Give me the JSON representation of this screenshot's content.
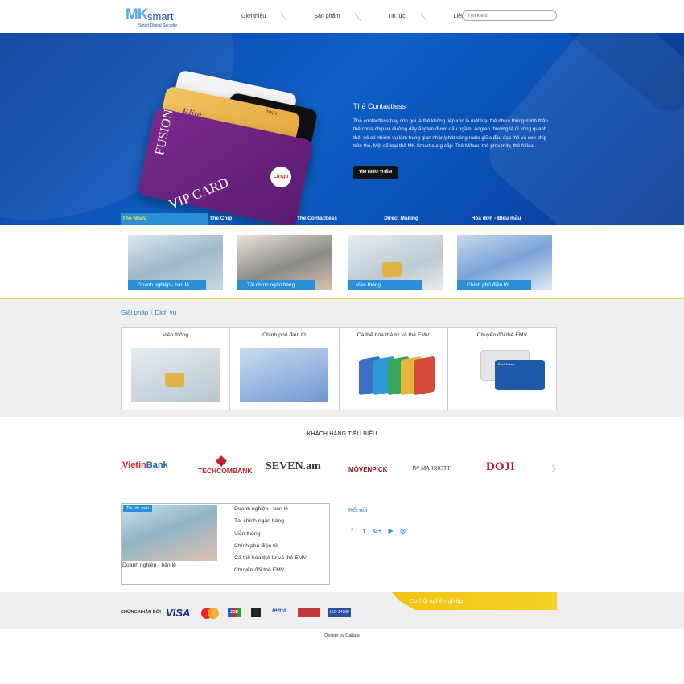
{
  "header": {
    "logo": {
      "mk": "MK",
      "smart": "smart",
      "tagline": "Smart Digital Security"
    },
    "nav": [
      {
        "label": "Giới thiệu"
      },
      {
        "label": "Sản phẩm"
      },
      {
        "label": "Tin tức"
      },
      {
        "label": "Liên hệ"
      }
    ],
    "search_placeholder": "Tìm kiếm"
  },
  "hero": {
    "title": "Thẻ Contactless",
    "description": "Thẻ contactless hay còn gọi là thẻ không tiếp xúc là một loại thẻ nhựa thông minh thân thẻ chứa chip và đường dây ăngten được dấu ngầm. Ăngten thường là đi vòng quanh thẻ, nó có nhiệm vụ làm trung gian nhận/phát sóng radio giữa đầu đọc thẻ và con chip trên thẻ.  Một số loại thẻ MK Smart cung cấp: Thẻ Mifare, thẻ proximity, thẻ felica.",
    "button": "TÌM HIỂU THÊM",
    "card_texts": {
      "fusion": "FUSION",
      "vip": "VIP CARD",
      "elite": "Elite",
      "tinh": "TINH",
      "badge": "Lingo"
    },
    "tabs": [
      {
        "label": "Thẻ Nhựa",
        "active": true
      },
      {
        "label": "Thẻ Chip",
        "active": false
      },
      {
        "label": "Thẻ Contactless",
        "active": false
      },
      {
        "label": "Direct Mailing",
        "active": false
      },
      {
        "label": "Hóa đơn - Biểu mẫu",
        "active": false
      }
    ]
  },
  "categories": [
    {
      "label": "Doanh nghiệp - bán lẻ"
    },
    {
      "label": "Tài chính ngân hàng"
    },
    {
      "label": "Viễn thông"
    },
    {
      "label": "Chính phủ điện tử"
    }
  ],
  "solutions": {
    "crumb": [
      "Giải pháp",
      "Dịch vụ"
    ],
    "crumb_sep": "\\",
    "items": [
      {
        "title": "Viễn thông"
      },
      {
        "title": "Chính phủ điện tử"
      },
      {
        "title": "Cá thể hóa thẻ từ và thẻ EMV"
      },
      {
        "title": "Chuyển đổi thẻ EMV"
      }
    ],
    "bank_card_text": "Bank Name"
  },
  "clients": {
    "title": "KHÁCH HÀNG TIÊU BIỂU",
    "logos": [
      {
        "name": "VietinBank",
        "prefix": "Vietin",
        "suffix": "Bank"
      },
      {
        "name": "TECHCOMBANK"
      },
      {
        "name": "SEVEN.am"
      },
      {
        "name": "MÖVENPICK"
      },
      {
        "name": "JW MARRIOTT"
      },
      {
        "name": "DOJI"
      }
    ]
  },
  "news": {
    "tag": "Tin tức mới",
    "caption": "Doanh nghiệp - bán lẻ",
    "items": [
      "Doanh nghiệp - bán lẻ",
      "Tài chính ngân hàng",
      "Viễn thông",
      "Chính phủ điện tử",
      "Cá thể hóa thẻ từ và thẻ EMV",
      "Chuyển đổi thẻ EMV"
    ]
  },
  "connect": {
    "title": "Kết nối",
    "socials": [
      {
        "icon": "facebook-icon",
        "glyph": "f"
      },
      {
        "icon": "twitter-icon",
        "glyph": "t"
      },
      {
        "icon": "google-plus-icon",
        "glyph": "G+"
      },
      {
        "icon": "youtube-icon",
        "glyph": "▶"
      },
      {
        "icon": "instagram-icon",
        "glyph": "◎"
      }
    ]
  },
  "certifications": {
    "label": "CHỨNG NHẬN BỞI",
    "visa": "VISA",
    "jcb": "JCB",
    "iema": "iema",
    "iso": "ISO 14000"
  },
  "career": {
    "label": "Cơ hội nghề nghiệp",
    "arrow": "→"
  },
  "footer": {
    "credit": "Design by Caitato"
  },
  "colors": {
    "brand_blue": "#1a4fa3",
    "accent_blue": "#2a8fd6",
    "yellow": "#f1c40f"
  }
}
